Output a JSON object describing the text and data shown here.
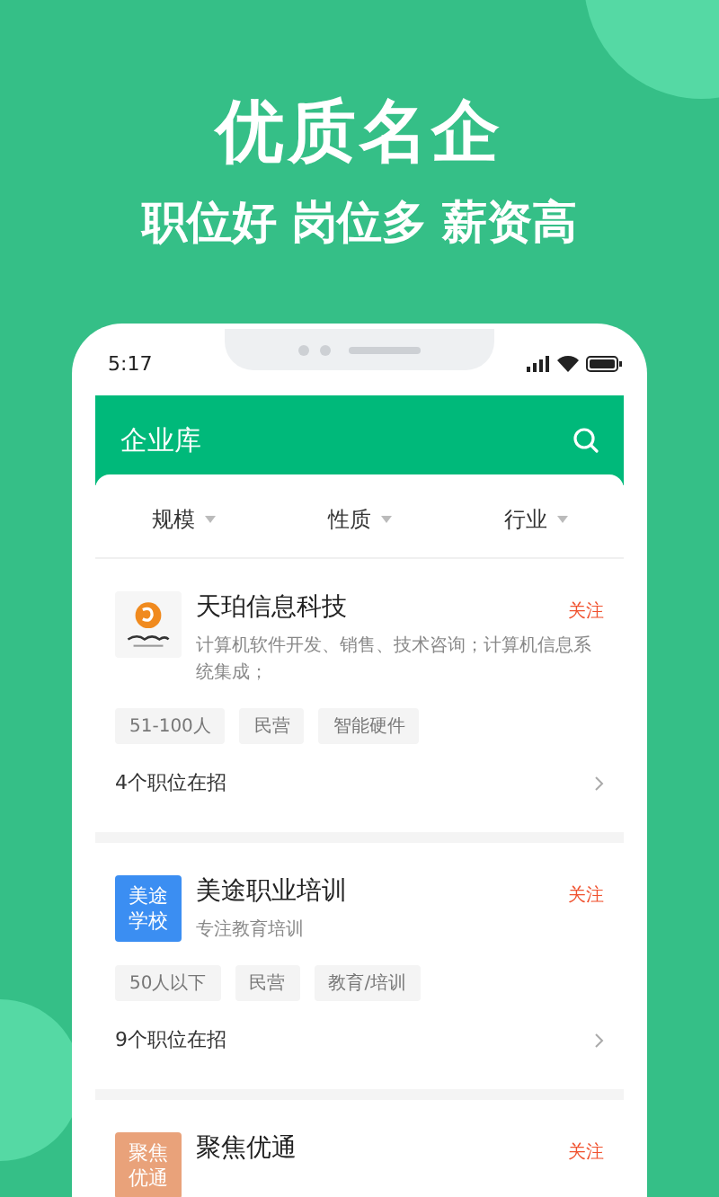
{
  "hero": {
    "title": "优质名企",
    "subtitle": "职位好 岗位多 薪资高"
  },
  "status_bar": {
    "time": "5:17"
  },
  "header": {
    "title": "企业库"
  },
  "filters": [
    {
      "label": "规模"
    },
    {
      "label": "性质"
    },
    {
      "label": "行业"
    }
  ],
  "companies": [
    {
      "logo": {
        "kind": "emblem"
      },
      "name": "天珀信息科技",
      "follow": "关注",
      "description": "计算机软件开发、销售、技术咨询；计算机信息系统集成；",
      "tags": [
        "51-100人",
        "民营",
        "智能硬件"
      ],
      "openings": "4个职位在招"
    },
    {
      "logo": {
        "kind": "text",
        "lines": [
          "美途",
          "学校"
        ],
        "color": "#3b8ef2"
      },
      "name": "美途职业培训",
      "follow": "关注",
      "description": "专注教育培训",
      "tags": [
        "50人以下",
        "民营",
        "教育/培训"
      ],
      "openings": "9个职位在招"
    },
    {
      "logo": {
        "kind": "text",
        "lines": [
          "聚焦",
          "优通"
        ],
        "color": "#e9a27a"
      },
      "name": "聚焦优通",
      "follow": "关注"
    }
  ]
}
